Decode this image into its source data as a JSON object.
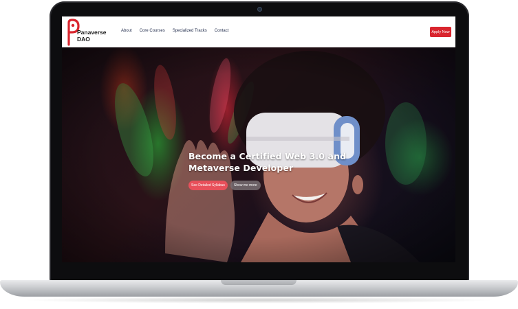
{
  "brand": {
    "line1": "Panaverse",
    "line2": "DAO",
    "accent": "#d9252e"
  },
  "nav": {
    "items": [
      {
        "label": "About"
      },
      {
        "label": "Core Courses"
      },
      {
        "label": "Specialized Tracks"
      },
      {
        "label": "Contact"
      }
    ],
    "cta_label": "Apply Now"
  },
  "hero": {
    "title": "Become a Certified Web 3.0 and Metaverse Developer",
    "primary_button": "See Detailed Syllabus",
    "secondary_button": "Show me more",
    "primary_color": "#e8505b"
  }
}
